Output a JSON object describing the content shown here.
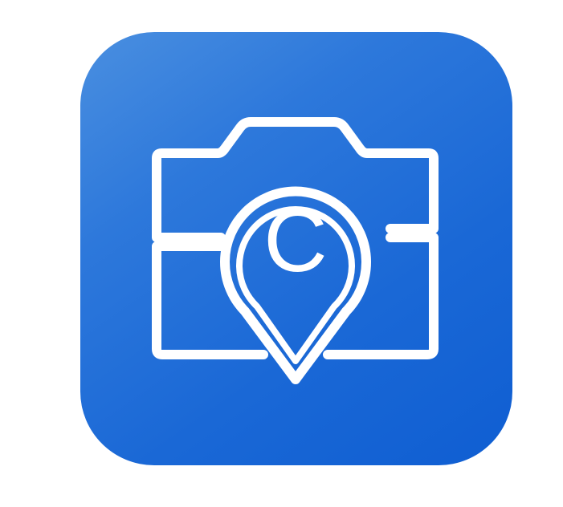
{
  "icon": {
    "name": "camera-location-copyright-icon",
    "background_color": "#1a68d6",
    "glyph_color": "#ffffff",
    "glyph_letter": "C"
  }
}
